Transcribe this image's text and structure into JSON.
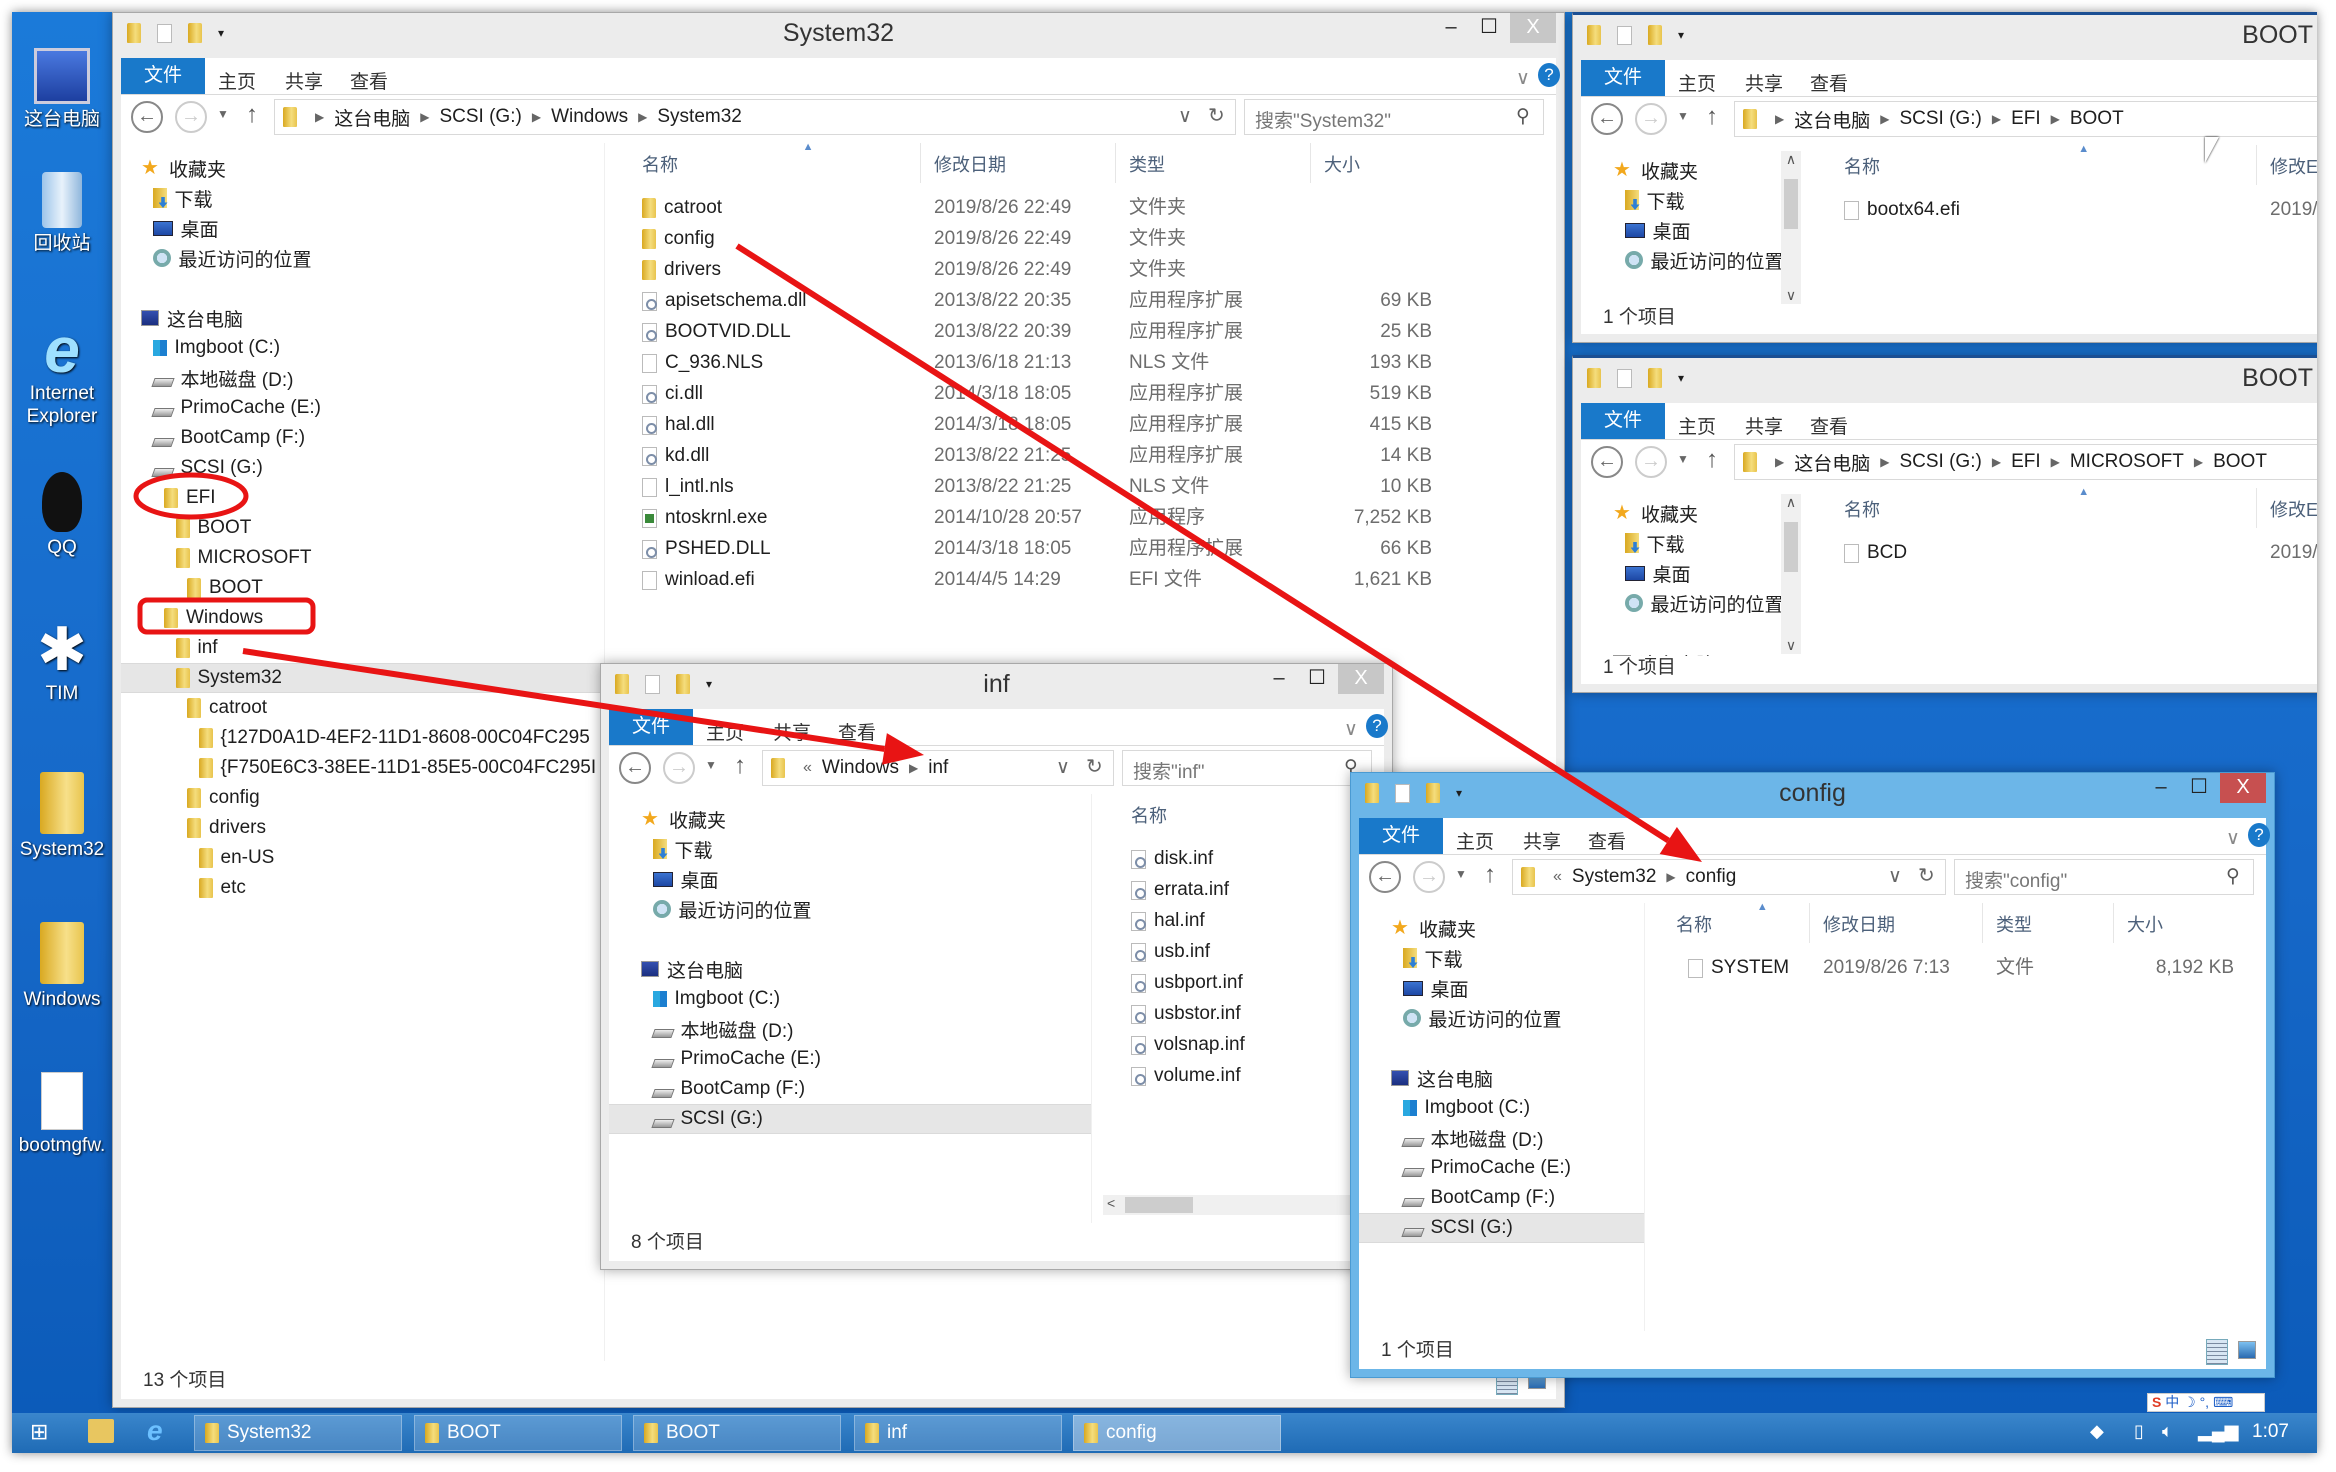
{
  "desktop": {
    "icons": [
      {
        "label": "这台电脑",
        "icon": "computer-icon"
      },
      {
        "label": "回收站",
        "icon": "recycle-bin-icon"
      },
      {
        "label": "Internet Explorer",
        "icon": "ie-icon"
      },
      {
        "label": "QQ",
        "icon": "qq-icon"
      },
      {
        "label": "TIM",
        "icon": "tim-icon"
      },
      {
        "label": "System32",
        "icon": "folder-icon"
      },
      {
        "label": "Windows",
        "icon": "folder-icon"
      },
      {
        "label": "bootmgfw.",
        "icon": "file-icon"
      }
    ]
  },
  "windows": {
    "system32": {
      "title": "System32",
      "tabs": [
        "文件",
        "主页",
        "共享",
        "查看"
      ],
      "breadcrumb": [
        "这台电脑",
        "SCSI (G:)",
        "Windows",
        "System32"
      ],
      "search_placeholder": "搜索\"System32\"",
      "nav_favorites": [
        {
          "label": "收藏夹",
          "icon": "star",
          "level": 0
        },
        {
          "label": "下载",
          "icon": "download",
          "level": 1
        },
        {
          "label": "桌面",
          "icon": "desktop",
          "level": 1
        },
        {
          "label": "最近访问的位置",
          "icon": "recent",
          "level": 1
        }
      ],
      "nav_computer": [
        {
          "label": "这台电脑",
          "icon": "pc",
          "level": 0
        },
        {
          "label": "Imgboot (C:)",
          "icon": "win-drive",
          "level": 1
        },
        {
          "label": "本地磁盘 (D:)",
          "icon": "drive",
          "level": 1
        },
        {
          "label": "PrimoCache (E:)",
          "icon": "drive",
          "level": 1
        },
        {
          "label": "BootCamp (F:)",
          "icon": "drive",
          "level": 1
        },
        {
          "label": "SCSI (G:)",
          "icon": "drive",
          "level": 1
        },
        {
          "label": "EFI",
          "icon": "folder",
          "level": 2
        },
        {
          "label": "BOOT",
          "icon": "folder",
          "level": 3
        },
        {
          "label": "MICROSOFT",
          "icon": "folder",
          "level": 3
        },
        {
          "label": "BOOT",
          "icon": "folder",
          "level": 4
        },
        {
          "label": "Windows",
          "icon": "folder",
          "level": 2
        },
        {
          "label": "inf",
          "icon": "folder",
          "level": 3
        },
        {
          "label": "System32",
          "icon": "folder",
          "level": 3,
          "selected": true
        },
        {
          "label": "catroot",
          "icon": "folder",
          "level": 4
        },
        {
          "label": "{127D0A1D-4EF2-11D1-8608-00C04FC295",
          "icon": "folder",
          "level": 5
        },
        {
          "label": "{F750E6C3-38EE-11D1-85E5-00C04FC295I",
          "icon": "folder",
          "level": 5
        },
        {
          "label": "config",
          "icon": "folder",
          "level": 4
        },
        {
          "label": "drivers",
          "icon": "folder",
          "level": 4
        },
        {
          "label": "en-US",
          "icon": "folder",
          "level": 5
        },
        {
          "label": "etc",
          "icon": "folder",
          "level": 5
        }
      ],
      "columns": [
        "名称",
        "修改日期",
        "类型",
        "大小"
      ],
      "rows": [
        {
          "icon": "folder",
          "name": "catroot",
          "date": "2019/8/26 22:49",
          "type": "文件夹",
          "size": ""
        },
        {
          "icon": "folder",
          "name": "config",
          "date": "2019/8/26 22:49",
          "type": "文件夹",
          "size": ""
        },
        {
          "icon": "folder",
          "name": "drivers",
          "date": "2019/8/26 22:49",
          "type": "文件夹",
          "size": ""
        },
        {
          "icon": "dll",
          "name": "apisetschema.dll",
          "date": "2013/8/22 20:35",
          "type": "应用程序扩展",
          "size": "69 KB"
        },
        {
          "icon": "dll",
          "name": "BOOTVID.DLL",
          "date": "2013/8/22 20:39",
          "type": "应用程序扩展",
          "size": "25 KB"
        },
        {
          "icon": "file",
          "name": "C_936.NLS",
          "date": "2013/6/18 21:13",
          "type": "NLS 文件",
          "size": "193 KB"
        },
        {
          "icon": "dll",
          "name": "ci.dll",
          "date": "2014/3/18 18:05",
          "type": "应用程序扩展",
          "size": "519 KB"
        },
        {
          "icon": "dll",
          "name": "hal.dll",
          "date": "2014/3/18 18:05",
          "type": "应用程序扩展",
          "size": "415 KB"
        },
        {
          "icon": "dll",
          "name": "kd.dll",
          "date": "2013/8/22 21:25",
          "type": "应用程序扩展",
          "size": "14 KB"
        },
        {
          "icon": "file",
          "name": "l_intl.nls",
          "date": "2013/8/22 21:25",
          "type": "NLS 文件",
          "size": "10 KB"
        },
        {
          "icon": "exe",
          "name": "ntoskrnl.exe",
          "date": "2014/10/28 20:57",
          "type": "应用程序",
          "size": "7,252 KB"
        },
        {
          "icon": "dll",
          "name": "PSHED.DLL",
          "date": "2014/3/18 18:05",
          "type": "应用程序扩展",
          "size": "66 KB"
        },
        {
          "icon": "file",
          "name": "winload.efi",
          "date": "2014/4/5 14:29",
          "type": "EFI 文件",
          "size": "1,621 KB"
        }
      ],
      "status": "13 个项目"
    },
    "boot1": {
      "title": "BOOT",
      "tabs": [
        "文件",
        "主页",
        "共享",
        "查看"
      ],
      "breadcrumb": [
        "这台电脑",
        "SCSI (G:)",
        "EFI",
        "BOOT"
      ],
      "nav_favorites": [
        {
          "label": "收藏夹",
          "icon": "star",
          "level": 0
        },
        {
          "label": "下载",
          "icon": "download",
          "level": 1
        },
        {
          "label": "桌面",
          "icon": "desktop",
          "level": 1
        },
        {
          "label": "最近访问的位置",
          "icon": "recent",
          "level": 1
        }
      ],
      "nav_computer": [],
      "columns": [
        "名称",
        "修改E"
      ],
      "rows": [
        {
          "icon": "file",
          "name": "bootx64.efi",
          "date": "2019/"
        }
      ],
      "status": "1 个项目"
    },
    "boot2": {
      "title": "BOOT",
      "tabs": [
        "文件",
        "主页",
        "共享",
        "查看"
      ],
      "breadcrumb": [
        "这台电脑",
        "SCSI (G:)",
        "EFI",
        "MICROSOFT",
        "BOOT"
      ],
      "nav_favorites": [
        {
          "label": "收藏夹",
          "icon": "star",
          "level": 0
        },
        {
          "label": "下载",
          "icon": "download",
          "level": 1
        },
        {
          "label": "桌面",
          "icon": "desktop",
          "level": 1
        },
        {
          "label": "最近访问的位置",
          "icon": "recent",
          "level": 1
        }
      ],
      "nav_computer": [
        {
          "label": "这台电脑",
          "icon": "pc",
          "level": 0
        }
      ],
      "columns": [
        "名称",
        "修改E"
      ],
      "rows": [
        {
          "icon": "file",
          "name": "BCD",
          "date": "2019/"
        }
      ],
      "status": "1 个项目"
    },
    "inf": {
      "title": "inf",
      "tabs": [
        "文件",
        "主页",
        "共享",
        "查看"
      ],
      "breadcrumb": [
        "Windows",
        "inf"
      ],
      "search_placeholder": "搜索\"inf\"",
      "nav_favorites": [
        {
          "label": "收藏夹",
          "icon": "star",
          "level": 0
        },
        {
          "label": "下载",
          "icon": "download",
          "level": 1
        },
        {
          "label": "桌面",
          "icon": "desktop",
          "level": 1
        },
        {
          "label": "最近访问的位置",
          "icon": "recent",
          "level": 1
        }
      ],
      "nav_computer": [
        {
          "label": "这台电脑",
          "icon": "pc",
          "level": 0
        },
        {
          "label": "Imgboot (C:)",
          "icon": "win-drive",
          "level": 1
        },
        {
          "label": "本地磁盘 (D:)",
          "icon": "drive",
          "level": 1
        },
        {
          "label": "PrimoCache (E:)",
          "icon": "drive",
          "level": 1
        },
        {
          "label": "BootCamp (F:)",
          "icon": "drive",
          "level": 1
        },
        {
          "label": "SCSI (G:)",
          "icon": "drive",
          "level": 1,
          "selected": true
        }
      ],
      "columns": [
        "名称"
      ],
      "rows": [
        {
          "icon": "dll",
          "name": "disk.inf"
        },
        {
          "icon": "dll",
          "name": "errata.inf"
        },
        {
          "icon": "dll",
          "name": "hal.inf"
        },
        {
          "icon": "dll",
          "name": "usb.inf"
        },
        {
          "icon": "dll",
          "name": "usbport.inf"
        },
        {
          "icon": "dll",
          "name": "usbstor.inf"
        },
        {
          "icon": "dll",
          "name": "volsnap.inf"
        },
        {
          "icon": "dll",
          "name": "volume.inf"
        }
      ],
      "status": "8 个项目"
    },
    "config": {
      "title": "config",
      "tabs": [
        "文件",
        "主页",
        "共享",
        "查看"
      ],
      "breadcrumb": [
        "System32",
        "config"
      ],
      "search_placeholder": "搜索\"config\"",
      "nav_favorites": [
        {
          "label": "收藏夹",
          "icon": "star",
          "level": 0
        },
        {
          "label": "下载",
          "icon": "download",
          "level": 1
        },
        {
          "label": "桌面",
          "icon": "desktop",
          "level": 1
        },
        {
          "label": "最近访问的位置",
          "icon": "recent",
          "level": 1
        }
      ],
      "nav_computer": [
        {
          "label": "这台电脑",
          "icon": "pc",
          "level": 0
        },
        {
          "label": "Imgboot (C:)",
          "icon": "win-drive",
          "level": 1
        },
        {
          "label": "本地磁盘 (D:)",
          "icon": "drive",
          "level": 1
        },
        {
          "label": "PrimoCache (E:)",
          "icon": "drive",
          "level": 1
        },
        {
          "label": "BootCamp (F:)",
          "icon": "drive",
          "level": 1
        },
        {
          "label": "SCSI (G:)",
          "icon": "drive",
          "level": 1,
          "selected": true
        }
      ],
      "columns": [
        "名称",
        "修改日期",
        "类型",
        "大小"
      ],
      "rows": [
        {
          "icon": "file",
          "name": "SYSTEM",
          "date": "2019/8/26 7:13",
          "type": "文件",
          "size": "8,192 KB"
        }
      ],
      "status": "1 个项目"
    }
  },
  "taskbar": {
    "tasks": [
      {
        "label": "System32",
        "active": false
      },
      {
        "label": "BOOT",
        "active": false
      },
      {
        "label": "BOOT",
        "active": false
      },
      {
        "label": "inf",
        "active": false
      },
      {
        "label": "config",
        "active": true
      }
    ],
    "ime": "中",
    "clock": "1:07"
  },
  "annotations": {
    "color": "#e81414"
  }
}
